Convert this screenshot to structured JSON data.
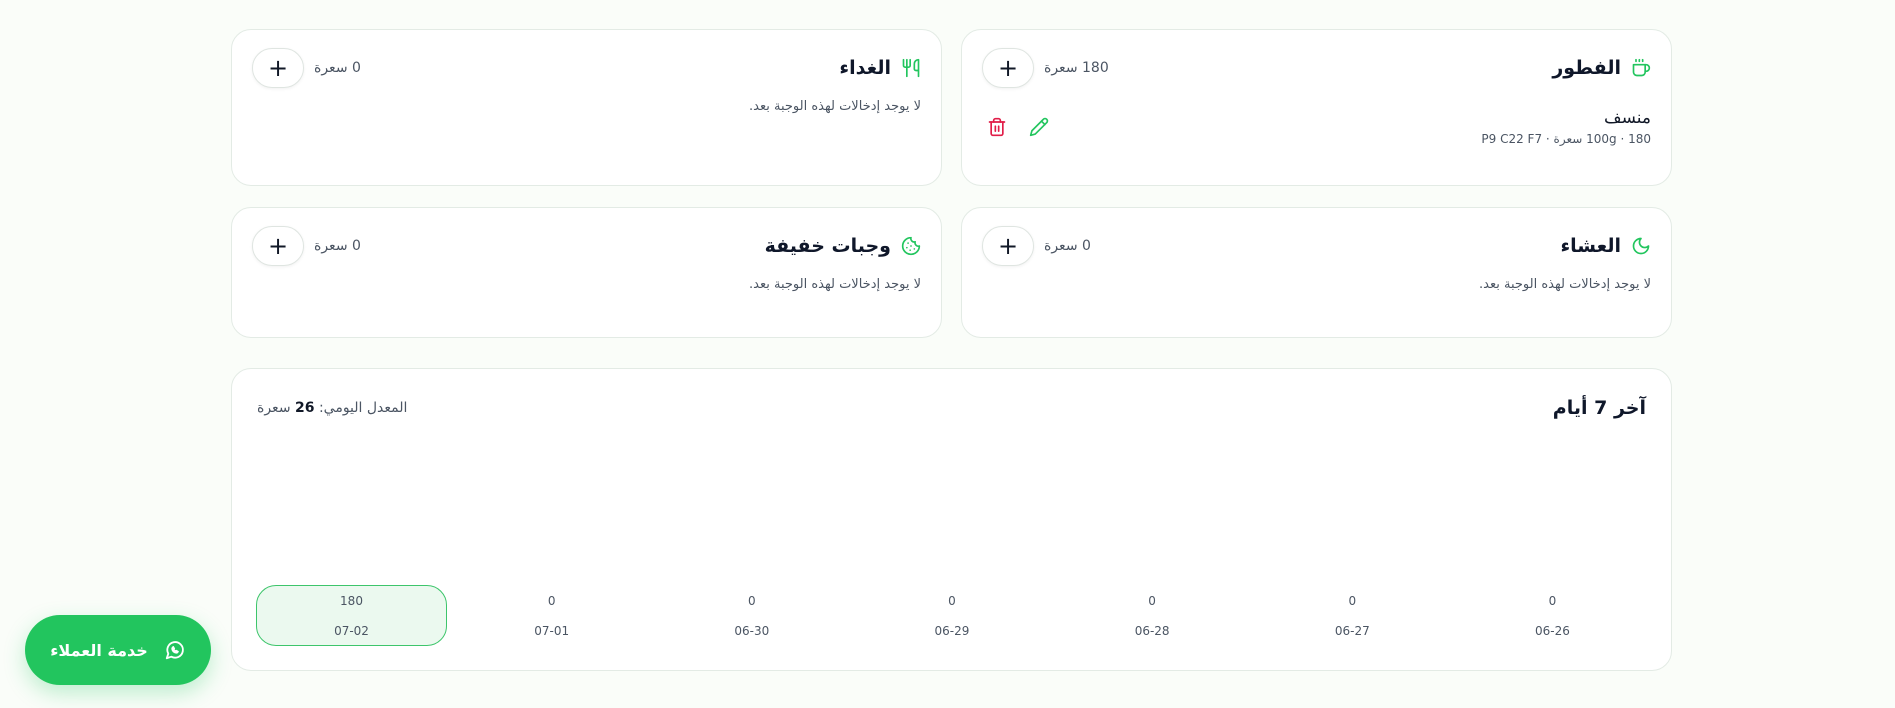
{
  "meals": [
    {
      "id": "breakfast",
      "name": "الفطور",
      "icon": "coffee-cup-icon",
      "kcal_text": "180 سعرة",
      "entries": [
        {
          "name": "منسف",
          "detail": "180 · 100g سعرة · P9 C22 F7"
        }
      ]
    },
    {
      "id": "lunch",
      "name": "الغداء",
      "icon": "utensils-icon",
      "kcal_text": "0 سعرة",
      "empty_text": "لا يوجد إدخالات لهذه الوجبة بعد."
    },
    {
      "id": "dinner",
      "name": "العشاء",
      "icon": "moon-icon",
      "kcal_text": "0 سعرة",
      "empty_text": "لا يوجد إدخالات لهذه الوجبة بعد."
    },
    {
      "id": "snacks",
      "name": "وجبات خفيفة",
      "icon": "cookie-icon",
      "kcal_text": "0 سعرة",
      "empty_text": "لا يوجد إدخالات لهذه الوجبة بعد."
    }
  ],
  "add_label": "+",
  "week": {
    "title": "آخر 7 أيام",
    "avg_label": "المعدل اليومي:",
    "avg_value": "26",
    "avg_unit": "سعرة",
    "days": [
      {
        "date": "07-02",
        "kcal": "180",
        "active": true
      },
      {
        "date": "07-01",
        "kcal": "0"
      },
      {
        "date": "06-30",
        "kcal": "0"
      },
      {
        "date": "06-29",
        "kcal": "0"
      },
      {
        "date": "06-28",
        "kcal": "0"
      },
      {
        "date": "06-27",
        "kcal": "0"
      },
      {
        "date": "06-26",
        "kcal": "0"
      }
    ]
  },
  "support": {
    "label": "خدمة العملاء",
    "icon": "whatsapp-icon"
  },
  "colors": {
    "accent": "#22c55e",
    "delete": "#e11d48",
    "active_day_bg": "#ebf9ef"
  }
}
